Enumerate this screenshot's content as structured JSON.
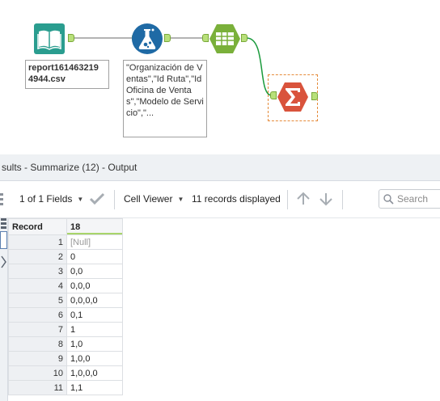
{
  "workflow": {
    "input_annotation": "report161463219\n4944.csv",
    "formula_annotation": "\"Organización de Ventas\",\"Id Ruta\",\"Id Oficina de Ventas\",\"Modelo de Servicio\",\"...",
    "colors": {
      "input_tool": "#2a9d8f",
      "formula_tool": "#1f6aa5",
      "text_tool": "#7ab03a",
      "summarize_tool": "#d9533c",
      "anchor": "#b8e07a",
      "wire": "#1a9a3c"
    }
  },
  "results": {
    "title": "sults - Summarize (12) - Output",
    "fields_selector": "1 of 1 Fields",
    "viewer_selector": "Cell Viewer",
    "records_text": "11 records displayed",
    "search_placeholder": "Search",
    "columns": [
      "Record",
      "18"
    ],
    "rows": [
      {
        "n": "1",
        "v": "[Null]"
      },
      {
        "n": "2",
        "v": "0"
      },
      {
        "n": "3",
        "v": "0,0"
      },
      {
        "n": "4",
        "v": "0,0,0"
      },
      {
        "n": "5",
        "v": "0,0,0,0"
      },
      {
        "n": "6",
        "v": "0,1"
      },
      {
        "n": "7",
        "v": "1"
      },
      {
        "n": "8",
        "v": "1,0"
      },
      {
        "n": "9",
        "v": "1,0,0"
      },
      {
        "n": "10",
        "v": "1,0,0,0"
      },
      {
        "n": "11",
        "v": "1,1"
      }
    ]
  }
}
